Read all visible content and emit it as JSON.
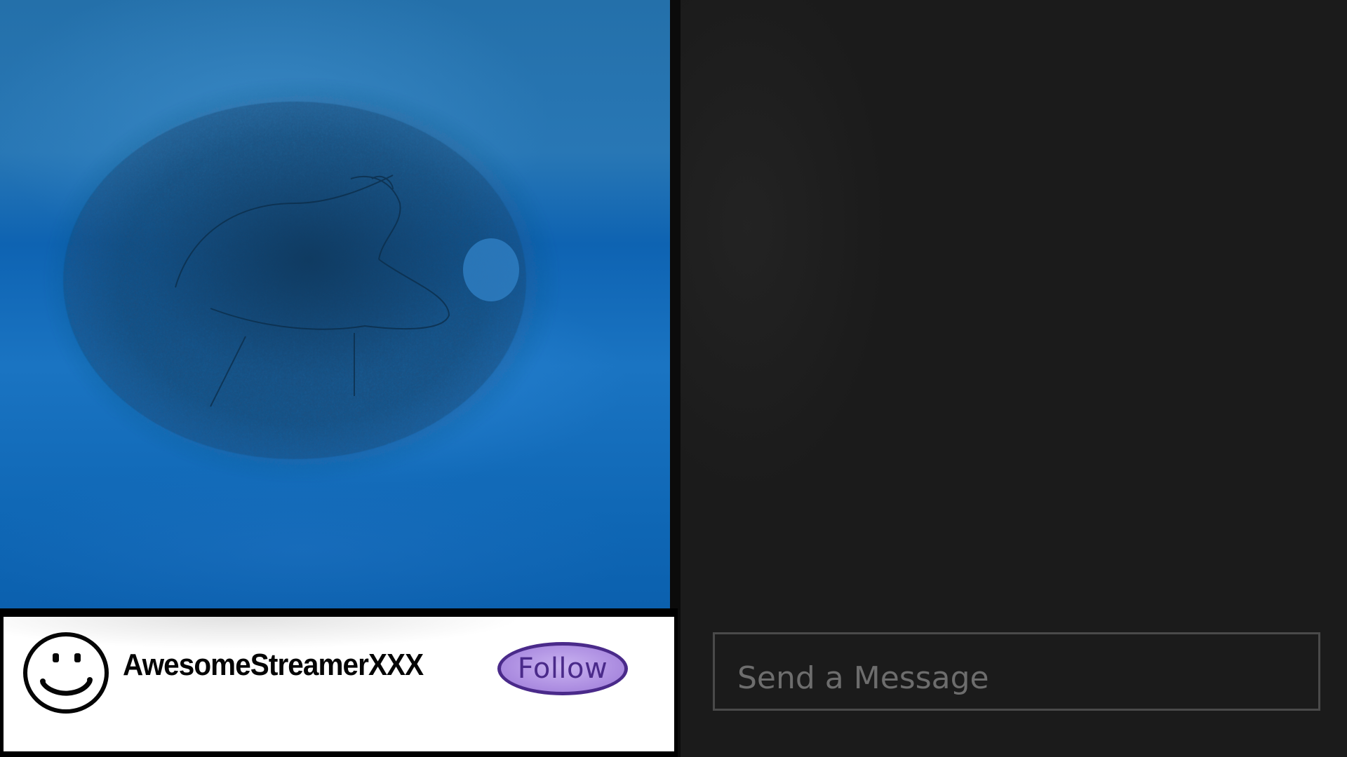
{
  "stream": {
    "video_description_icon": "blue-scribble-thumbnail"
  },
  "streamer": {
    "name": "AwesomeStreamerXXX",
    "avatar_icon": "smiley-face-icon",
    "follow_label": "Follow"
  },
  "chat": {
    "message_placeholder": "Send a Message",
    "message_value": ""
  },
  "colors": {
    "follow_fill": "#b092e3",
    "follow_border": "#4a2a8a",
    "chat_background": "#1b1b1b",
    "video_blue": "#1a74c2"
  }
}
